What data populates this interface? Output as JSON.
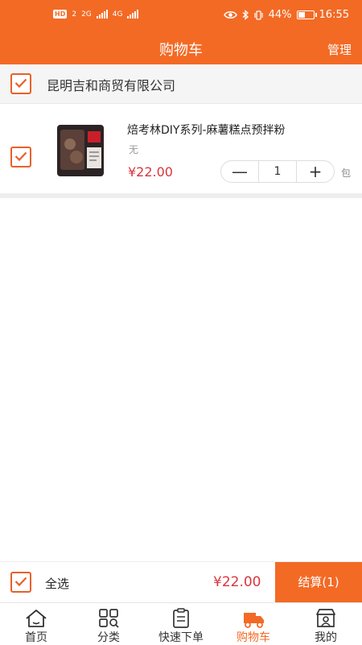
{
  "status_bar": {
    "hd": "HD",
    "sim1": "2",
    "net1": "2G",
    "net2": "4G",
    "battery": "44%",
    "time": "16:55"
  },
  "header": {
    "title": "购物车",
    "manage_label": "管理"
  },
  "shop": {
    "name": "昆明吉和商贸有限公司",
    "checked": true
  },
  "cart_items": [
    {
      "name": "焙考林DIY系列-麻薯糕点预拌粉",
      "spec": "无",
      "price": "¥22.00",
      "quantity": "1",
      "minus": "—",
      "plus": "+",
      "unit": "包",
      "checked": true
    }
  ],
  "footer": {
    "select_all_label": "全选",
    "total": "¥22.00",
    "checkout_label": "结算(1)"
  },
  "tabs": [
    {
      "label": "首页",
      "icon": "home-icon"
    },
    {
      "label": "分类",
      "icon": "category-icon"
    },
    {
      "label": "快速下单",
      "icon": "clipboard-icon"
    },
    {
      "label": "购物车",
      "icon": "truck-icon",
      "active": true
    },
    {
      "label": "我的",
      "icon": "store-profile-icon"
    }
  ],
  "colors": {
    "brand": "#f36a25",
    "price": "#d9363e"
  }
}
